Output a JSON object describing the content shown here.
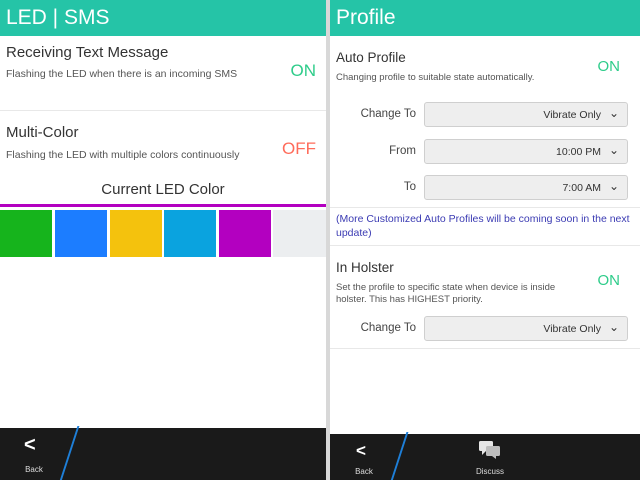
{
  "left": {
    "title": "LED | SMS",
    "receiving": {
      "title": "Receiving Text Message",
      "desc": "Flashing the LED when there is an incoming SMS",
      "state": "ON"
    },
    "multicolor": {
      "title": "Multi-Color",
      "desc": "Flashing the LED with multiple colors continuously",
      "state": "OFF"
    },
    "led_heading": "Current LED Color",
    "led_colors": [
      "#16b41c",
      "#1c7dff",
      "#f4c20d",
      "#0aa3df",
      "#b300c0",
      "#eceef0"
    ],
    "back_label": "Back"
  },
  "right": {
    "title": "Profile",
    "auto_profile": {
      "title": "Auto Profile",
      "desc": "Changing profile to suitable state automatically.",
      "state": "ON"
    },
    "change_to_label": "Change To",
    "change_to_value": "Vibrate Only",
    "from_label": "From",
    "from_value": "10:00 PM",
    "to_label": "To",
    "to_value": "7:00 AM",
    "note": "(More Customized Auto Profiles will be coming soon in the next update)",
    "in_holster": {
      "title": "In Holster",
      "desc": "Set the profile to specific state when device is inside holster. This has HIGHEST priority.",
      "state": "ON"
    },
    "holster_change_to_label": "Change To",
    "holster_change_to_value": "Vibrate Only",
    "back_label": "Back",
    "discuss_label": "Discuss"
  },
  "colors": {
    "accent": "#25c4a7",
    "on": "#2ecc8a",
    "off": "#ff6b5a",
    "note": "#3b3bb3"
  }
}
